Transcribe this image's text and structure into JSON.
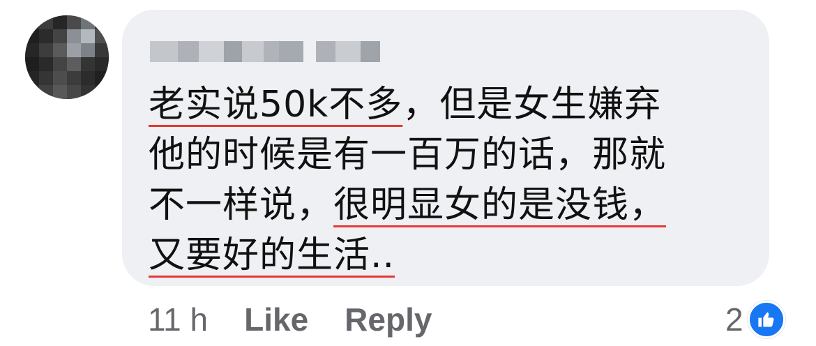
{
  "comment": {
    "lines": [
      [
        {
          "text": "老实说50k不多",
          "underline": true
        },
        {
          "text": "，但是女生嫌弃",
          "underline": false
        }
      ],
      [
        {
          "text": "他的时候是有一百万的话，那就",
          "underline": false
        }
      ],
      [
        {
          "text": "不一样说，",
          "underline": false
        },
        {
          "text": "很明显女的是没钱，",
          "underline": true
        }
      ],
      [
        {
          "text": "又要好的生活..",
          "underline": true
        }
      ]
    ]
  },
  "actions": {
    "time": "11 h",
    "like_label": "Like",
    "reply_label": "Reply"
  },
  "reactions": {
    "count": "2",
    "icon": "thumbs-up-icon"
  },
  "colors": {
    "bubble": "#eef0f3",
    "underline": "#e53935",
    "meta_text": "#65676b",
    "like_blue": "#1877f2"
  }
}
